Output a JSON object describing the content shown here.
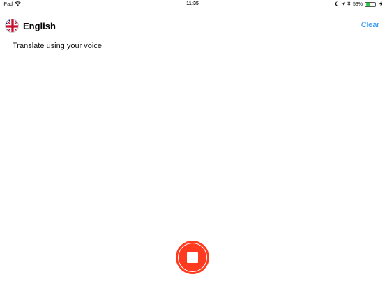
{
  "status_bar": {
    "device": "iPad",
    "time": "11:35",
    "battery_percent": "53%",
    "battery_level": 0.53,
    "icons": [
      "wifi-icon",
      "moon-icon",
      "location-arrow-icon",
      "bluetooth-icon",
      "battery-icon",
      "charging-icon"
    ]
  },
  "header": {
    "language": "English",
    "flag_icon": "uk-flag-icon",
    "clear_label": "Clear"
  },
  "content": {
    "hint": "Translate using your voice"
  },
  "record": {
    "state": "recording",
    "icon": "stop-icon",
    "color": "#ff3b1f"
  },
  "colors": {
    "accent": "#1f8ef1",
    "stop": "#ff3b1f"
  }
}
